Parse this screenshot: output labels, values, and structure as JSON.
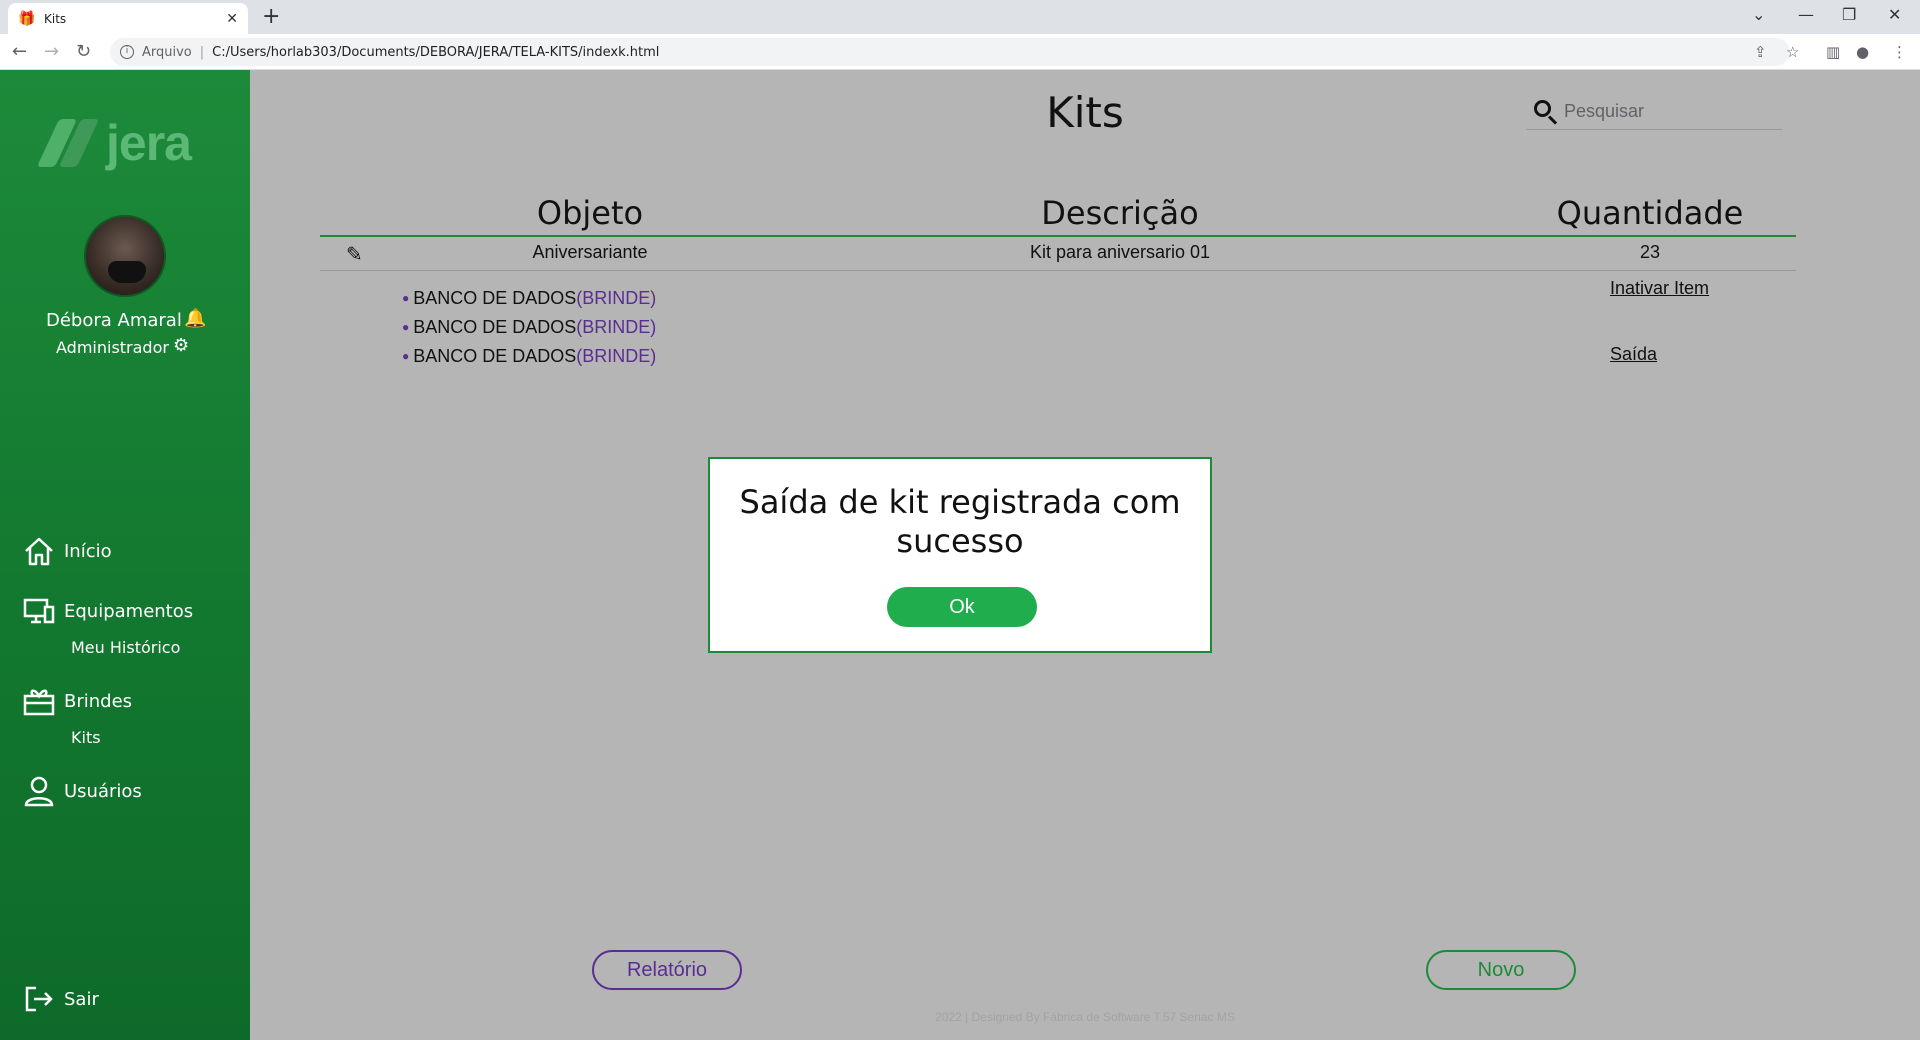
{
  "browser": {
    "tab_title": "Kits",
    "tab_close": "✕",
    "new_tab": "+",
    "address_scheme": "Arquivo",
    "address_url": "C:/Users/horlab303/Documents/DEBORA/JERA/TELA-KITS/indexk.html"
  },
  "sidebar": {
    "logo_text": "jera",
    "user_name": "Débora Amaral",
    "user_role": "Administrador",
    "nav": {
      "inicio": "Início",
      "equipamentos": "Equipamentos",
      "meu_historico": "Meu Histórico",
      "brindes": "Brindes",
      "kits": "Kits",
      "usuarios": "Usuários",
      "sair": "Sair"
    }
  },
  "main": {
    "title": "Kits",
    "search_placeholder": "Pesquisar",
    "columns": [
      "Objeto",
      "Descrição",
      "Quantidade"
    ],
    "row": {
      "objeto": "Aniversariante",
      "descricao": "Kit para aniversario 01",
      "quantidade": "23"
    },
    "sub_items": [
      {
        "name": "BANCO DE DADOS",
        "tag": "(BRINDE)"
      },
      {
        "name": "BANCO DE DADOS",
        "tag": "(BRINDE)"
      },
      {
        "name": "BANCO DE DADOS",
        "tag": "(BRINDE)"
      }
    ],
    "link_inativar": "Inativar Item",
    "link_saida": "Saída",
    "btn_relatorio": "Relatório",
    "btn_novo": "Novo",
    "footer": "2022 | Designed By Fábrica de Software T.57 Senac MS"
  },
  "modal": {
    "message": "Saída de kit registrada com sucesso",
    "ok_label": "Ok"
  },
  "colors": {
    "brand_green": "#1d8a3a",
    "accent_purple": "#5a2d91",
    "ok_green": "#1fad4e"
  }
}
